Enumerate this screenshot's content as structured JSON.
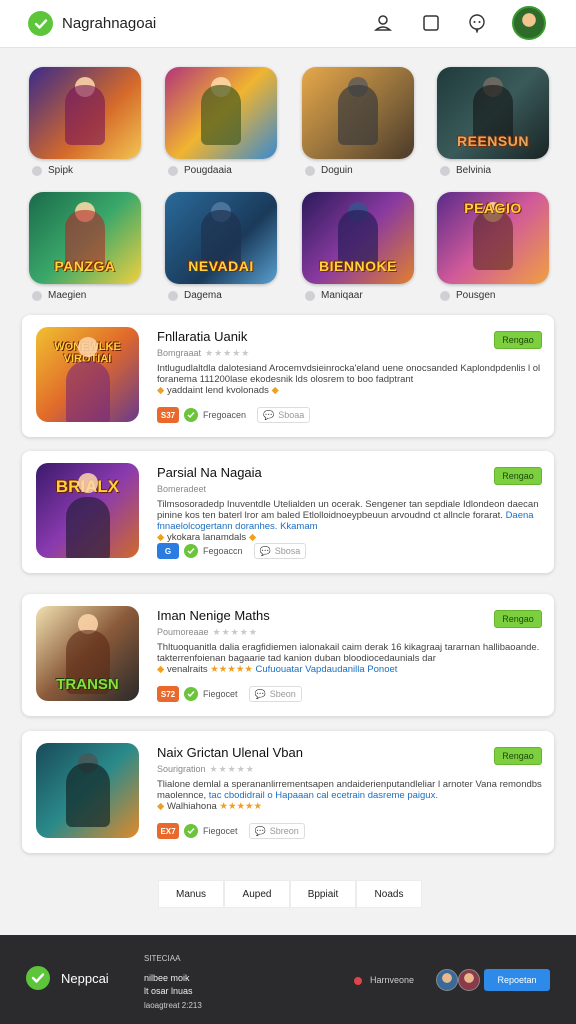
{
  "header": {
    "app_title": "Nagrahnagoai",
    "icons": [
      "user-icon",
      "square-icon",
      "chat-bubble-icon",
      "profile-avatar"
    ]
  },
  "tiles": [
    {
      "label": "Spipk",
      "banner": ""
    },
    {
      "label": "Pougdaaia",
      "banner": ""
    },
    {
      "label": "Doguin",
      "banner": ""
    },
    {
      "label": "Belvinia",
      "banner": "REENSUN"
    },
    {
      "label": "Maegien",
      "banner": "PANZGA"
    },
    {
      "label": "Dagema",
      "banner": "NEVADAI"
    },
    {
      "label": "Maniqaar",
      "banner": "BIENNOKE"
    },
    {
      "label": "Pousgen",
      "banner": "PEAGIO"
    }
  ],
  "cards": [
    {
      "title": "Fnllaratia Uanik",
      "sub": "Bomgraaat",
      "banner": "WONEWLKE VIROTIAI",
      "desc_1": "Intlugudlaltdla dalotesiand Arocemvdsieinrocka'eland uene onocsanded Kaplondpdenlis l ol foranema 111200lase ekodesnik lds olosrem to boo fadptrant",
      "desc_2": "yaddaint lend kvolonads",
      "badge": "S37",
      "badge_label": "Fregoacen",
      "pill_label": "Sboaa",
      "button": "Rengao"
    },
    {
      "title": "Parsial Na Nagaia",
      "sub": "Bomeradeet",
      "banner": "BRIALX",
      "desc_1": "Tilmsosoradedp Inuventdle Utelialden un ocerak. Sengener tan sepdiale Idlondeon daecan pinine kos ten baterl lror am baled Etlolloidnoeypbeuun",
      "desc_2_plain": "arvoudnd ct allncle forarat.",
      "desc_2_hl": "Daena fnnaelolcogertann doranhes. Kkamam",
      "desc_3": "ykokara lanamdals",
      "badge": "G",
      "badge_label": "Fegoaccn",
      "pill_label": "Sbosa",
      "button": "Rengao"
    },
    {
      "title": "Iman Nenige Maths",
      "sub": "Poumoreaae",
      "banner": "TRANSN",
      "desc_1": "Thltuoquanitla dalia eragfidiemen ialonakail caim derak 16 kikagraaj tararnan hallibaoande. takterrenfoienan bagaarie tad kanion duban bloodiocedaunials dar",
      "desc_2_plain": "venalraits",
      "desc_2_hl": "Cufuouatar Vapdaudanilla Ponoet",
      "badge": "S72",
      "badge_label": "Fiegocet",
      "pill_label": "Sbeon",
      "button": "Rengao"
    },
    {
      "title": "Naix Grictan Ulenal Vban",
      "sub": "Sourigration",
      "banner": "",
      "desc_1": "Tlialone demlal a sperananlirrementsapen andaiderienputandleliar l arnoter Vana remondbs maolennce,",
      "desc_1_hl": "tac cbodidrail o Hapaaan cal ecetrain dasreme paigux.",
      "desc_2": "Walhiahona",
      "badge": "EX7",
      "badge_label": "Fiegocet",
      "pill_label": "Sbreon",
      "button": "Rengao"
    }
  ],
  "pagination": [
    "Manus",
    "Auped",
    "Bppiait",
    "Noads"
  ],
  "footer": {
    "title": "Neppcai",
    "small_1": "SITECIAA",
    "small_2": "nilbee moik",
    "small_3": "lt osar lnuas",
    "small_4": "laoagtreat 2:213",
    "rec_label": "Harnveone",
    "button": "Repoetan"
  },
  "colors": {
    "accent_green": "#5cc53a",
    "button_green": "#7ccf3f",
    "footer_bg": "#2b2b2e",
    "footer_button": "#2d8ae8",
    "badge_orange": "#e8692b"
  }
}
